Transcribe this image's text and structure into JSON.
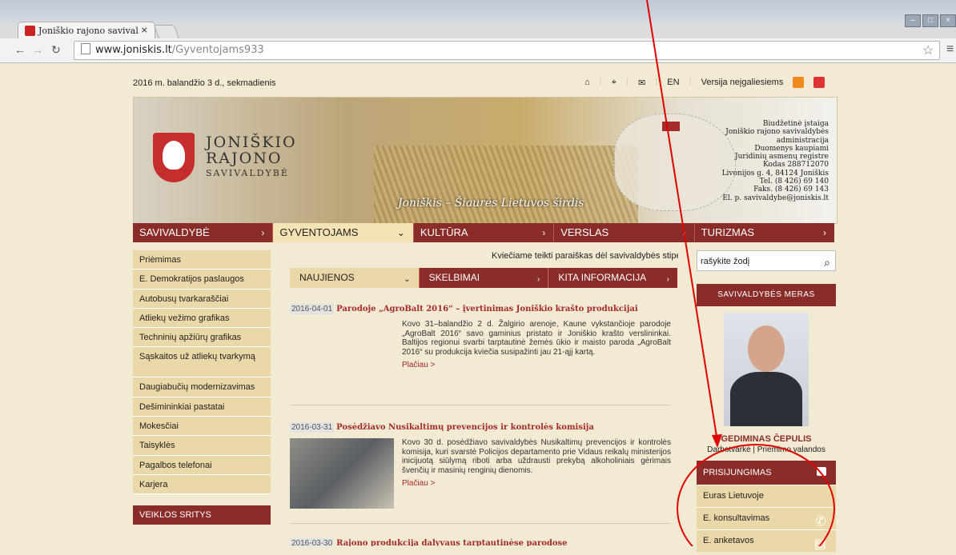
{
  "browser": {
    "tab_title": "Joniškio rajono savival",
    "tab_close": "×",
    "url_domain": "www.joniskis.lt",
    "url_path": "/Gyventojams933"
  },
  "header": {
    "date": "2016 m. balandžio 3 d., sekmadienis",
    "lang": "EN",
    "accessible": "Versija neįgaliesiems"
  },
  "banner": {
    "brand_line1": "JONIŠKIO",
    "brand_line2": "RAJONO",
    "brand_line3": "SAVIVALDYBĖ",
    "slogan": "Joniškis – Šiaurės Lietuvos širdis",
    "info": [
      "Biudžetinė įstaiga",
      "Joniškio rajono savivaldybės",
      "administracija",
      "Duomenys kaupiami",
      "Juridinių asmenų registre",
      "Kodas 288712070",
      "Livonijos g. 4, 84124 Joniškis",
      "Tel. (8 426) 69 140",
      "Faks. (8 426) 69 143",
      "El. p. savivaldybe@joniskis.lt"
    ]
  },
  "nav": [
    "SAVIVALDYBĖ",
    "GYVENTOJAMS",
    "KULTŪRA",
    "VERSLAS",
    "TURIZMAS"
  ],
  "sidebar": {
    "items": [
      "Priėmimas",
      "E. Demokratijos paslaugos",
      "Autobusų tvarkaraščiai",
      "Atliekų vežimo grafikas",
      "Techninių apžiūrų grafikas",
      "Sąskaitos už atliekų tvarkymą",
      "Daugiabučių modernizavimas",
      "Dešimininkiai pastatai",
      "Mokesčiai",
      "Taisyklės",
      "Pagalbos telefonai",
      "Karjera"
    ],
    "section": "VEIKLOS SRITYS"
  },
  "ticker": "Kviečiame teikti paraiškas dėl savivaldybės stipen",
  "news_tabs": [
    "NAUJIENOS",
    "SKELBIMAI",
    "KITA INFORMACIJA"
  ],
  "news": [
    {
      "date": "2016-04-01",
      "title": "Parodoje „AgroBalt 2016“ – įvertinimas Joniškio krašto produkcijai",
      "text": "Kovo 31–balandžio 2 d. Žalgirio arenoje, Kaune vykstančioje parodoje „AgroBalt 2016“ savo gaminius pristato ir Joniškio krašto verslininkai. Baltijos regionui svarbi tarptautinė žemės ūkio ir maisto paroda „AgroBalt 2016“ su produkcija kviečia susipažinti jau 21-ąjį kartą.",
      "more": "Plačiau >"
    },
    {
      "date": "2016-03-31",
      "title": "Posėdžiavo Nusikaltimų prevencijos ir kontrolės komisija",
      "text": "Kovo 30 d. posėdžiavo savivaldybės Nusikaltimų prevencijos ir kontrolės komisija, kuri svarstė Policijos departamento prie Vidaus reikalų ministerijos inicijuotą siūlymą riboti arba uždrausti prekybą alkoholiniais gėrimais švenčių ir masinių renginių dienomis.",
      "more": "Plačiau >"
    },
    {
      "date": "2016-03-30",
      "title": "Rajono produkcija dalyvaus tarptautinėse parodose",
      "text": "",
      "more": ""
    }
  ],
  "right": {
    "search_placeholder": "rašykite žodį",
    "mayor_head": "SAVIVALDYBĖS MERAS",
    "mayor_name": "GEDIMINAS ČEPULIS",
    "mayor_link1": "Darbotvarkė",
    "mayor_sep": "|",
    "mayor_link2": "Priėmimo valandos",
    "login": "PRISIJUNGIMAS",
    "links": [
      "Euras Lietuvoje",
      "E. konsultavimas",
      "E. anketavos"
    ]
  },
  "annotation_color": "#e00000"
}
